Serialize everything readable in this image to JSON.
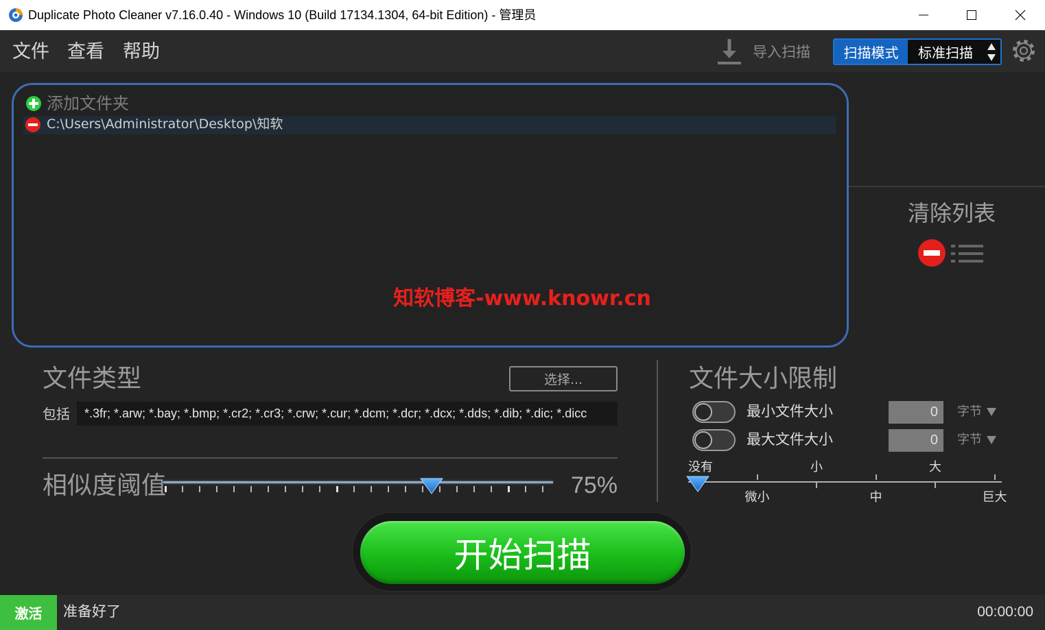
{
  "window": {
    "title": "Duplicate Photo Cleaner v7.16.0.40 - Windows 10 (Build 17134.1304, 64-bit Edition) - 管理员",
    "app_icon": "app-logo-icon",
    "minimize_icon": "minimize-icon",
    "maximize_icon": "maximize-icon",
    "close_icon": "close-icon"
  },
  "menu": {
    "items": [
      {
        "label": "文件"
      },
      {
        "label": "查看"
      },
      {
        "label": "帮助"
      }
    ],
    "import_scan": {
      "icon": "download-icon",
      "label": "导入扫描"
    },
    "scan_mode": {
      "label": "扫描模式",
      "value": "标准扫描",
      "stepper_icon": "up-down-arrows-icon"
    },
    "settings_icon": "gear-icon"
  },
  "folders": {
    "add_icon": "plus-circle-icon",
    "add_label": "添加文件夹",
    "items": [
      {
        "remove_icon": "minus-circle-icon",
        "path": "C:\\Users\\Administrator\\Desktop\\知软"
      }
    ]
  },
  "watermark": {
    "text": "知软博客-www.knowr.cn"
  },
  "clear_list": {
    "label": "清除列表",
    "remove_icon": "minus-circle-icon",
    "list_icon": "list-icon"
  },
  "file_types": {
    "title": "文件类型",
    "select_button": "选择...",
    "include_label": "包括",
    "include_value": "*.3fr; *.arw; *.bay; *.bmp; *.cr2; *.cr3; *.crw; *.cur; *.dcm; *.dcr; *.dcx; *.dds; *.dib; *.dic; *.dicc"
  },
  "similarity": {
    "title": "相似度阈值",
    "value": 75,
    "label": "75%"
  },
  "size_limit": {
    "title": "文件大小限制",
    "min": {
      "label": "最小文件大小",
      "enabled": false,
      "value": "0",
      "unit": "字节",
      "dropdown_icon": "triangle-down-icon"
    },
    "max": {
      "label": "最大文件大小",
      "enabled": false,
      "value": "0",
      "unit": "字节",
      "dropdown_icon": "triangle-down-icon"
    },
    "scale": {
      "labels": [
        "没有",
        "微小",
        "小",
        "中",
        "大",
        "巨大"
      ],
      "selected_index": 0
    }
  },
  "start_button": {
    "label": "开始扫描"
  },
  "status": {
    "activate": "激活",
    "message": "准备好了",
    "time": "00:00:00"
  },
  "colors": {
    "title_bar": "#ffffff",
    "chrome": "#2b2b2b",
    "background": "#242424",
    "accent_blue": "#1565c0",
    "panel_border": "#3d6cb5",
    "add_green": "#2ecc40",
    "remove_red": "#e3201b",
    "watermark_red": "#e8201c",
    "start_green": "#1abc1a",
    "activate_green": "#3fbf3f",
    "text_muted": "#9a9a9a"
  }
}
